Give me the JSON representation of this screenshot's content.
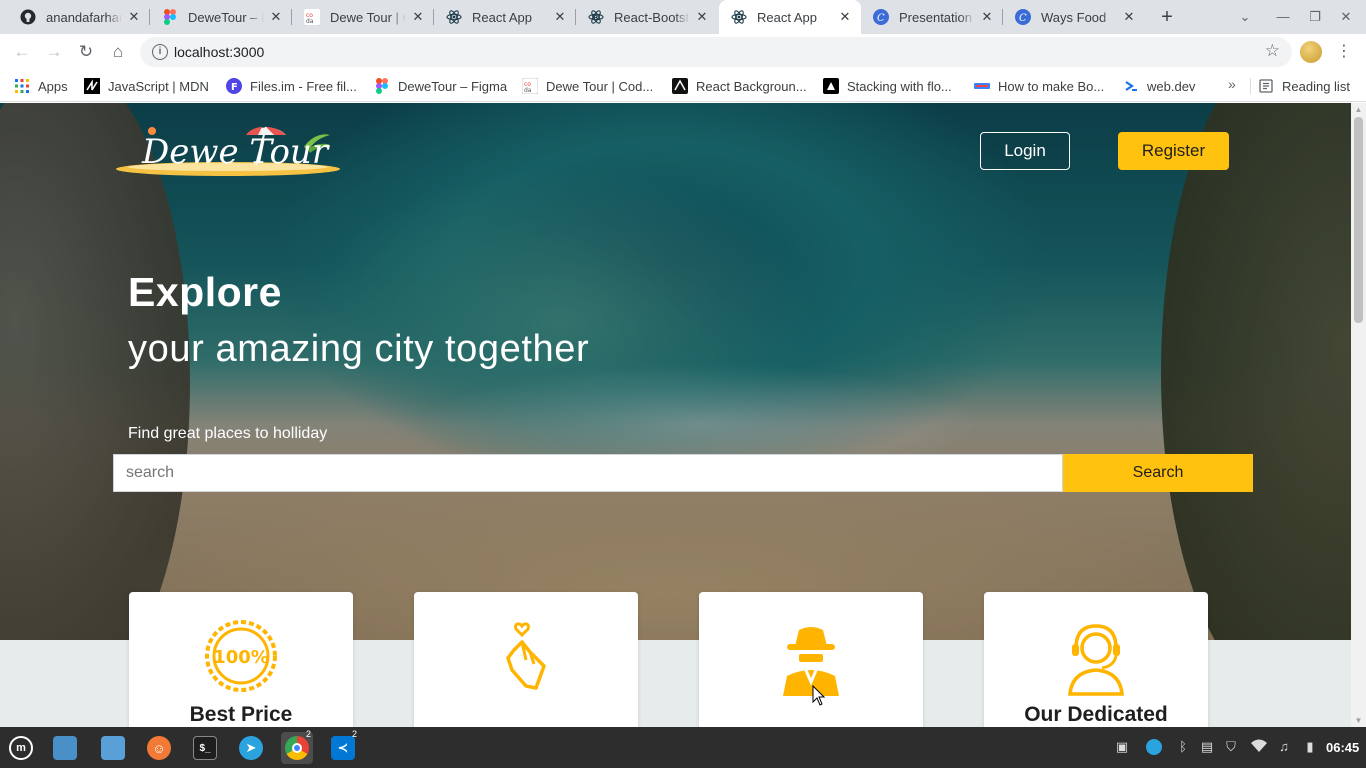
{
  "browser": {
    "tabs": [
      {
        "title": "anandafarhan",
        "icon": "github-icon"
      },
      {
        "title": "DeweTour – Figma",
        "icon": "figma-icon"
      },
      {
        "title": "Dewe Tour | Codewars",
        "icon": "codewars-icon"
      },
      {
        "title": "React App",
        "icon": "react-icon"
      },
      {
        "title": "React-Bootstrap",
        "icon": "react-bootstrap-icon"
      },
      {
        "title": "React App",
        "icon": "react-icon",
        "active": true
      },
      {
        "title": "Presentation",
        "icon": "canva-icon"
      },
      {
        "title": "Ways Food",
        "icon": "canva-icon"
      }
    ],
    "new_tab": "+",
    "url": "localhost:3000",
    "bookmarks": [
      {
        "label": "Apps",
        "icon": "apps-grid-icon"
      },
      {
        "label": "JavaScript | MDN",
        "icon": "mdn-icon"
      },
      {
        "label": "Files.im - Free fil...",
        "icon": "files-im-icon"
      },
      {
        "label": "DeweTour – Figma",
        "icon": "figma-icon"
      },
      {
        "label": "Dewe Tour | Cod...",
        "icon": "codewars-icon"
      },
      {
        "label": "React Backgroun...",
        "icon": "react-bg-icon"
      },
      {
        "label": "Stacking with flo...",
        "icon": "stack-icon"
      },
      {
        "label": "How to make Bo...",
        "icon": "bootstrap-icon"
      },
      {
        "label": "web.dev",
        "icon": "webdev-icon"
      }
    ],
    "reading_list": "Reading list"
  },
  "page": {
    "logo_text": "Dewe Tour",
    "nav": {
      "login": "Login",
      "register": "Register"
    },
    "hero": {
      "title": "Explore",
      "subtitle": "your amazing city together",
      "tagline": "Find great places to holliday"
    },
    "search": {
      "placeholder": "search",
      "button": "Search"
    },
    "cards": [
      {
        "title": "Best Price",
        "icon": "badge-100-icon"
      },
      {
        "title": "",
        "icon": "finger-heart-icon"
      },
      {
        "title": "",
        "icon": "spy-agent-icon"
      },
      {
        "title": "Our Dedicated",
        "icon": "headset-support-icon"
      }
    ]
  },
  "taskbar": {
    "apps": [
      {
        "name": "menu-icon"
      },
      {
        "name": "files-icon"
      },
      {
        "name": "folder-icon"
      },
      {
        "name": "firefox-icon"
      },
      {
        "name": "terminal-icon"
      },
      {
        "name": "telegram-icon"
      },
      {
        "name": "chrome-icon",
        "badge": "2"
      },
      {
        "name": "vscode-icon",
        "badge": "2"
      }
    ],
    "clock": "06:45"
  },
  "colors": {
    "accent": "#ffc20e",
    "tab_strip": "#dee1e6"
  }
}
